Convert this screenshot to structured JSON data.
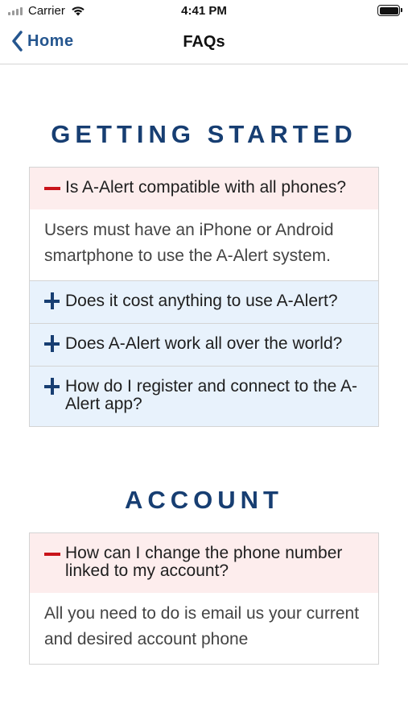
{
  "status": {
    "carrier": "Carrier",
    "time": "4:41 PM"
  },
  "nav": {
    "back_label": "Home",
    "title": "FAQs"
  },
  "sections": [
    {
      "title": "GETTING STARTED",
      "items": [
        {
          "question": "Is A-Alert compatible with all phones?",
          "expanded": true,
          "answer": "Users must have an iPhone or Android smartphone to use the A-Alert system."
        },
        {
          "question": "Does it cost anything to use A-Alert?",
          "expanded": false
        },
        {
          "question": "Does A-Alert work all over the world?",
          "expanded": false
        },
        {
          "question": "How do I register and connect to the A-Alert app?",
          "expanded": false
        }
      ]
    },
    {
      "title": "ACCOUNT",
      "items": [
        {
          "question": "How can I change the phone number linked to my account?",
          "expanded": true,
          "answer": "All you need to do is email us your current and desired account phone"
        }
      ]
    }
  ],
  "colors": {
    "accent": "#173e72",
    "nav_link": "#25568f",
    "open_bg": "#fdeded",
    "closed_bg": "#e8f2fc",
    "minus": "#c9141a"
  },
  "icons": {
    "back": "chevron-left-icon",
    "expanded": "minus-icon",
    "collapsed": "plus-icon"
  }
}
